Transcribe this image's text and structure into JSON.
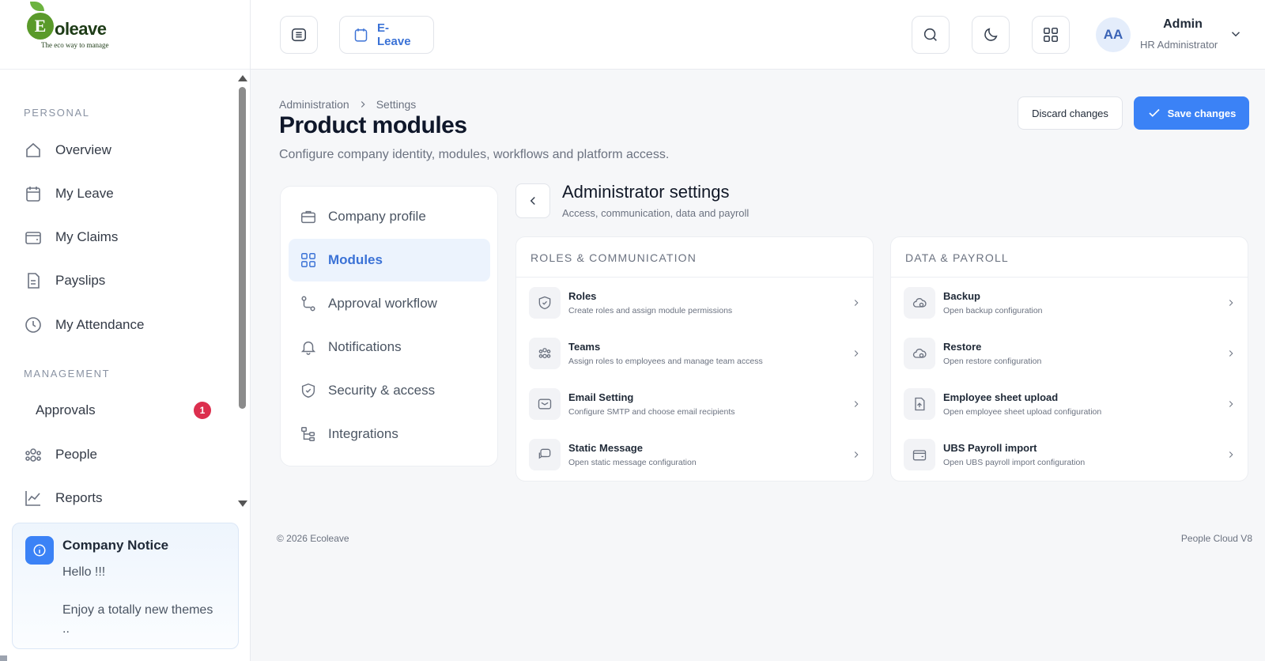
{
  "logo": {
    "word": "Ecoleave",
    "initial": "E",
    "rest": "oleave",
    "tagline": "The eco way to manage"
  },
  "sidebar": {
    "personal_label": "PERSONAL",
    "management_label": "MANAGEMENT",
    "personal_items": [
      {
        "label": "Overview",
        "icon": "home-icon"
      },
      {
        "label": "My Leave",
        "icon": "calendar-icon"
      },
      {
        "label": "My Claims",
        "icon": "wallet-icon"
      },
      {
        "label": "Payslips",
        "icon": "document-icon"
      },
      {
        "label": "My Attendance",
        "icon": "clock-icon"
      }
    ],
    "management_items": [
      {
        "label": "Approvals",
        "badge": "1"
      },
      {
        "label": "People",
        "icon": "people-icon"
      },
      {
        "label": "Reports",
        "icon": "chart-icon"
      }
    ],
    "notice": {
      "title": "Company Notice",
      "body": "Hello !!!\n\nEnjoy a totally new themes\n.."
    }
  },
  "topbar": {
    "eleave_label": "E-Leave",
    "avatar_initials": "AA",
    "user_name": "Admin",
    "user_role": "HR Administrator"
  },
  "page": {
    "breadcrumb": [
      "Administration",
      "Settings"
    ],
    "title": "Product modules",
    "subtitle": "Configure company identity, modules, workflows and platform access.",
    "discard_label": "Discard changes",
    "save_label": "Save changes"
  },
  "settings_menu": [
    {
      "label": "Company profile",
      "icon": "briefcase-icon"
    },
    {
      "label": "Modules",
      "icon": "grid-icon",
      "active": true
    },
    {
      "label": "Approval workflow",
      "icon": "workflow-icon"
    },
    {
      "label": "Notifications",
      "icon": "bell-icon"
    },
    {
      "label": "Security & access",
      "icon": "shield-icon"
    },
    {
      "label": "Integrations",
      "icon": "integration-icon"
    }
  ],
  "admin_panel": {
    "title": "Administrator settings",
    "subtitle": "Access, communication, data and payroll",
    "groups": [
      {
        "heading": "ROLES & COMMUNICATION",
        "rows": [
          {
            "title": "Roles",
            "desc": "Create roles and assign module permissions",
            "icon": "shield-check-icon"
          },
          {
            "title": "Teams",
            "desc": "Assign roles to employees and manage team access",
            "icon": "team-icon"
          },
          {
            "title": "Email Setting",
            "desc": "Configure SMTP and choose email recipients",
            "icon": "mail-icon"
          },
          {
            "title": "Static Message",
            "desc": "Open static message configuration",
            "icon": "message-icon"
          }
        ]
      },
      {
        "heading": "DATA & PAYROLL",
        "rows": [
          {
            "title": "Backup",
            "desc": "Open backup configuration",
            "icon": "cloud-icon"
          },
          {
            "title": "Restore",
            "desc": "Open restore configuration",
            "icon": "cloud-restore-icon"
          },
          {
            "title": "Employee sheet upload",
            "desc": "Open employee sheet upload configuration",
            "icon": "upload-icon"
          },
          {
            "title": "UBS Payroll import",
            "desc": "Open UBS payroll import configuration",
            "icon": "wallet-icon"
          }
        ]
      }
    ]
  },
  "footer": {
    "copyright": "© 2026 Ecoleave",
    "version": "People Cloud V8"
  },
  "colors": {
    "accent": "#3b82f6",
    "badge": "#dc2f4e",
    "active_bg": "#ecf3fd"
  }
}
